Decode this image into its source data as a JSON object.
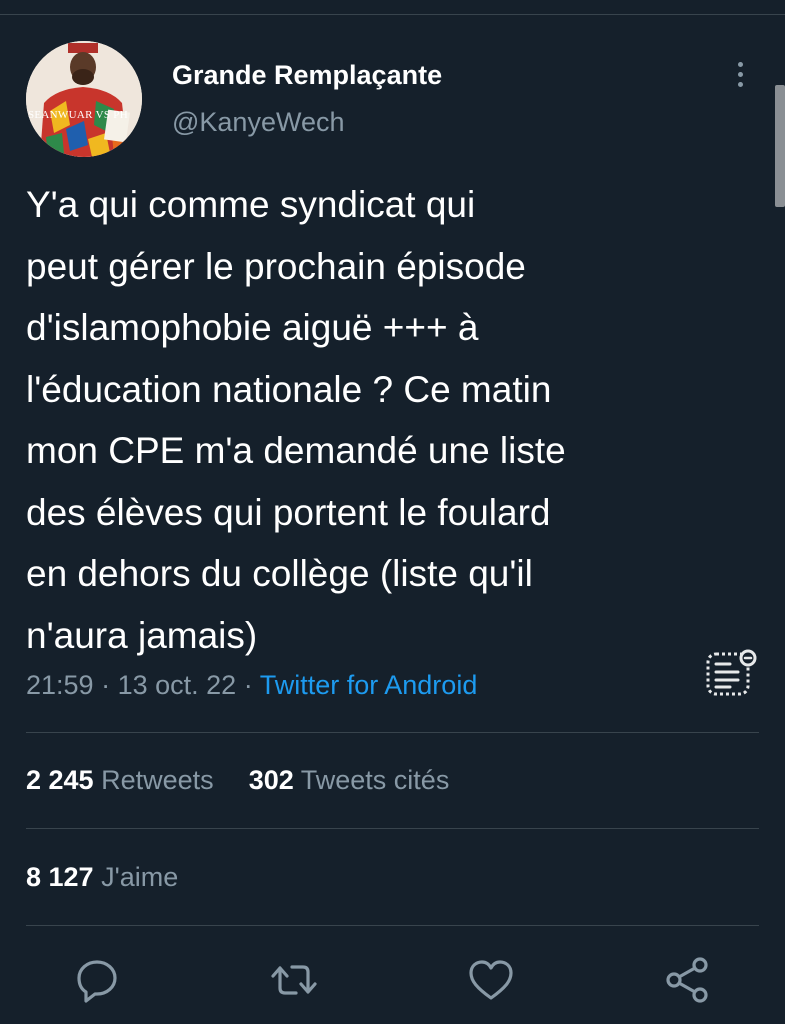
{
  "user": {
    "display_name": "Grande Remplaçante",
    "handle": "@KanyeWech",
    "avatar_caption": "SEANWUAR VS PH"
  },
  "tweet": {
    "text": "Y'a qui comme syndicat qui\npeut gérer le prochain épisode\nd'islamophobie aiguë +++ à\nl'éducation nationale ? Ce matin\nmon CPE m'a demandé une liste\ndes élèves qui portent le foulard\nen dehors du collège (liste qu'il\nn'aura jamais)",
    "time": "21:59",
    "date": "13 oct. 22",
    "separator": "·",
    "source": "Twitter for Android"
  },
  "stats": {
    "retweets_count": "2 245",
    "retweets_label": "Retweets",
    "quotes_count": "302",
    "quotes_label": "Tweets cités",
    "likes_count": "8 127",
    "likes_label": "J'aime"
  },
  "icons": {
    "more": "more-vertical-icon",
    "analytics": "analytics-icon",
    "reply": "reply-icon",
    "retweet": "retweet-icon",
    "like": "heart-icon",
    "share": "share-icon"
  },
  "colors": {
    "background": "#15202b",
    "text": "#ffffff",
    "secondary": "#8899a6",
    "link": "#1d9bf0",
    "divider": "#38444d"
  }
}
